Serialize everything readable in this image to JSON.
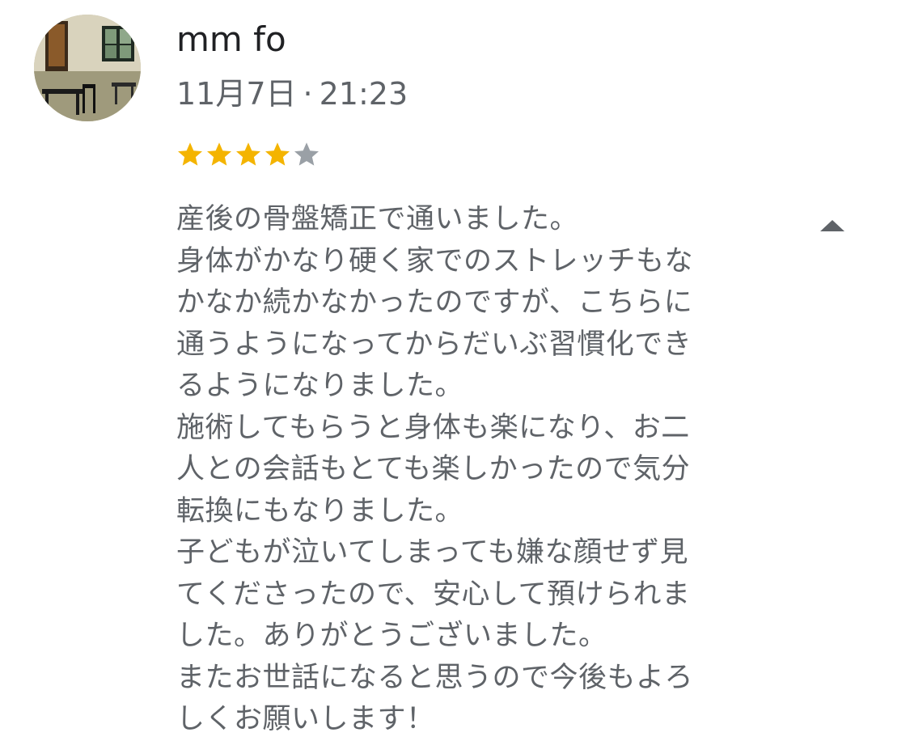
{
  "review": {
    "reviewer_name": "mm fo",
    "date": "11月7日",
    "separator": "·",
    "time": "21:23",
    "rating": 4,
    "rating_max": 5,
    "star_filled_color": "#f4b400",
    "star_empty_color": "#9aa0a6",
    "text_lines": [
      "産後の骨盤矯正で通いました。",
      "身体がかなり硬く家でのストレッチもな",
      "かなか続かなかったのですが、こちらに",
      "通うようになってからだいぶ習慣化でき",
      "るようになりました。",
      "施術してもらうと身体も楽になり、お二",
      "人との会話もとても楽しかったので気分",
      "転換にもなりました。",
      "子どもが泣いてしまっても嫌な顔せず見",
      "てくださったので、安心して預けられま",
      "した。ありがとうございました。",
      "またお世話になると思うので今後もよろ",
      "しくお願いします！"
    ],
    "collapse_icon": "triangle-up-icon",
    "avatar_icon": "profile-photo-cafe"
  }
}
